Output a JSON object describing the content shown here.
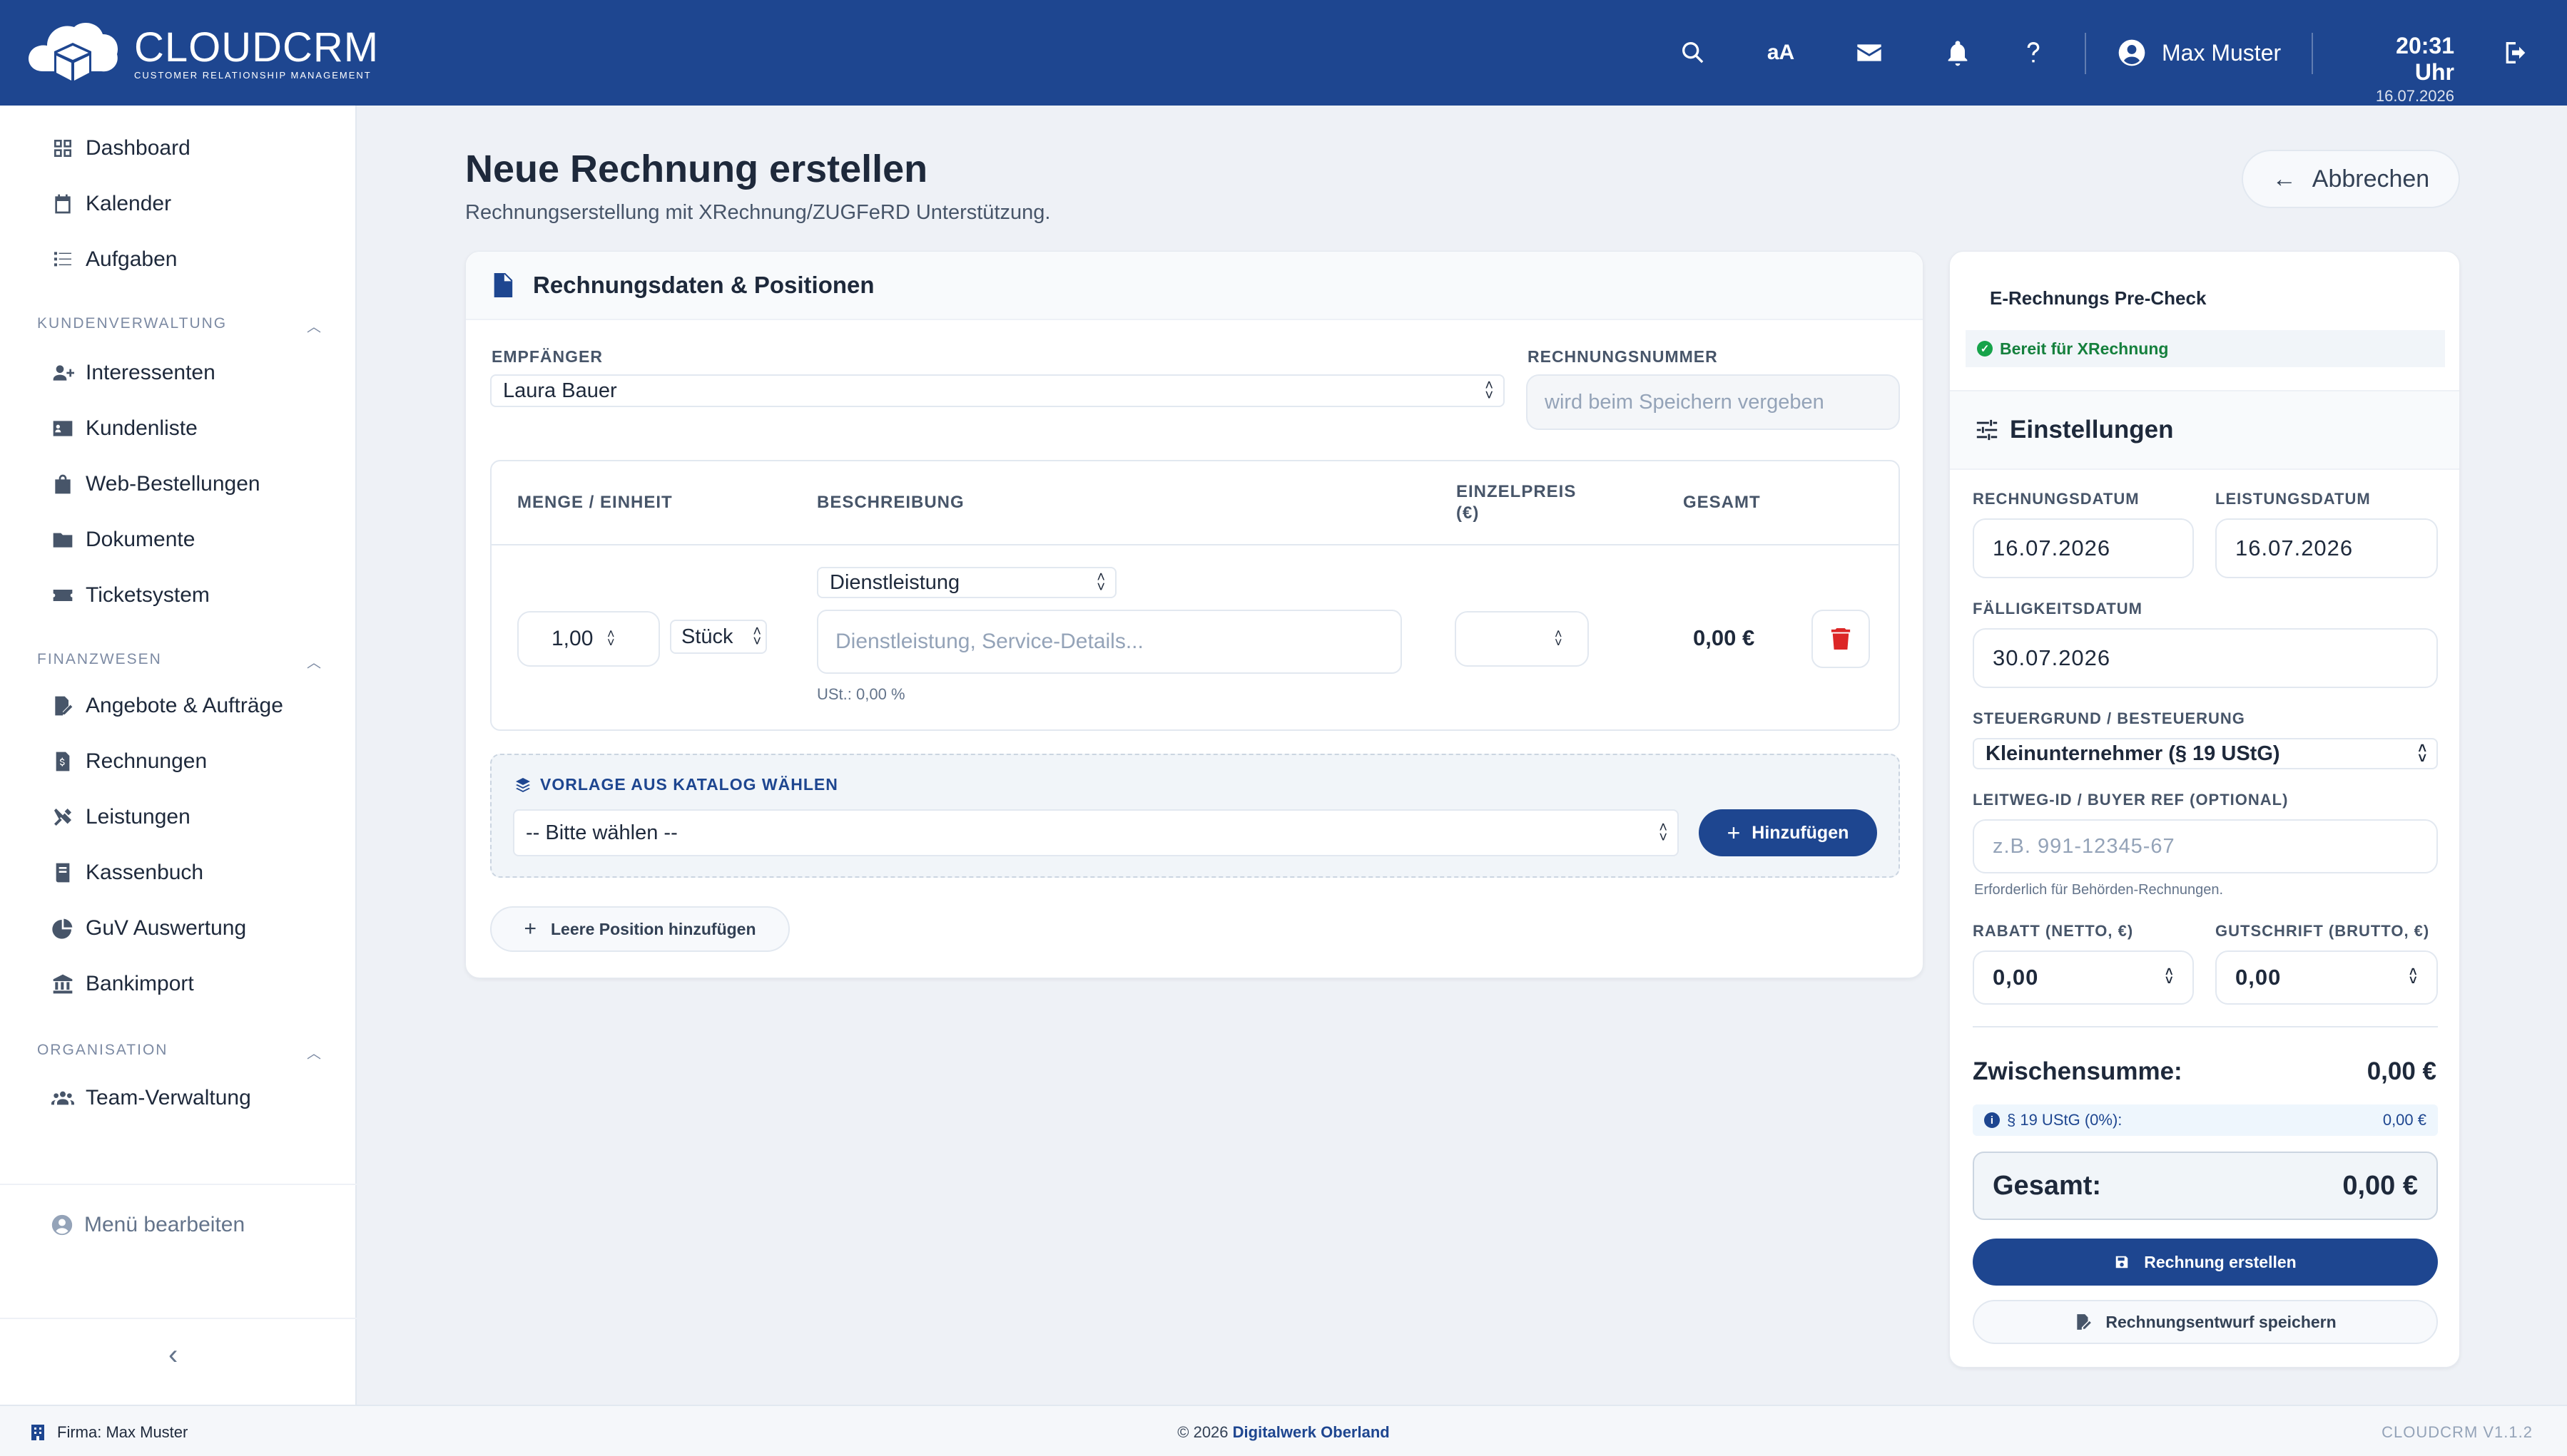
{
  "header": {
    "brand_title": "CLOUDCRM",
    "brand_subtitle": "CUSTOMER RELATIONSHIP MANAGEMENT",
    "font_size_label": "aA",
    "user_name": "Max Muster",
    "time": "20:31 Uhr",
    "date": "16.07.2026"
  },
  "sidebar": {
    "top_items": [
      {
        "label": "Dashboard",
        "icon": "dashboard-icon"
      },
      {
        "label": "Kalender",
        "icon": "calendar-icon"
      },
      {
        "label": "Aufgaben",
        "icon": "tasks-icon"
      }
    ],
    "sections": [
      {
        "title": "KUNDENVERWALTUNG",
        "items": [
          {
            "label": "Interessenten",
            "icon": "user-plus-icon"
          },
          {
            "label": "Kundenliste",
            "icon": "address-card-icon"
          },
          {
            "label": "Web-Bestellungen",
            "icon": "shopping-bag-icon"
          },
          {
            "label": "Dokumente",
            "icon": "folder-icon"
          },
          {
            "label": "Ticketsystem",
            "icon": "ticket-icon"
          }
        ]
      },
      {
        "title": "FINANZWESEN",
        "items": [
          {
            "label": "Angebote & Aufträge",
            "icon": "file-signature-icon"
          },
          {
            "label": "Rechnungen",
            "icon": "invoice-icon"
          },
          {
            "label": "Leistungen",
            "icon": "tools-icon"
          },
          {
            "label": "Kassenbuch",
            "icon": "book-icon"
          },
          {
            "label": "GuV Auswertung",
            "icon": "pie-chart-icon"
          },
          {
            "label": "Bankimport",
            "icon": "bank-icon"
          }
        ]
      },
      {
        "title": "ORGANISATION",
        "items": [
          {
            "label": "Team-Verwaltung",
            "icon": "users-icon"
          }
        ]
      }
    ],
    "menu_edit": "Menü bearbeiten"
  },
  "page": {
    "title": "Neue Rechnung erstellen",
    "subtitle": "Rechnungserstellung mit XRechnung/ZUGFeRD Unterstützung.",
    "cancel_label": "Abbrechen"
  },
  "form": {
    "card_title": "Rechnungsdaten & Positionen",
    "recipient_label": "EMPFÄNGER",
    "recipient_value": "Laura Bauer",
    "invoice_number_label": "RECHNUNGSNUMMER",
    "invoice_number_placeholder": "wird beim Speichern vergeben",
    "table_headers": {
      "qty": "MENGE / EINHEIT",
      "desc": "BESCHREIBUNG",
      "unit_price": "EINZELPREIS (€)",
      "total": "GESAMT"
    },
    "row": {
      "qty": "1,00",
      "unit": "Stück",
      "type": "Dienstleistung",
      "desc_placeholder": "Dienstleistung, Service-Details...",
      "vat_note": "USt.: 0,00 %",
      "total": "0,00 €"
    },
    "catalog_label": "VORLAGE AUS KATALOG WÄHLEN",
    "catalog_select": "-- Bitte wählen --",
    "add_label": "Hinzufügen",
    "empty_position_label": "Leere Position hinzufügen"
  },
  "side": {
    "precheck_title": "E-Rechnungs Pre-Check",
    "precheck_status": "Bereit für XRechnung",
    "settings_title": "Einstellungen",
    "invoice_date_label": "RECHNUNGSDATUM",
    "invoice_date": "16.07.2026",
    "service_date_label": "LEISTUNGSDATUM",
    "service_date": "16.07.2026",
    "due_date_label": "FÄLLIGKEITSDATUM",
    "due_date": "30.07.2026",
    "tax_label": "STEUERGRUND / BESTEUERUNG",
    "tax_value": "Kleinunternehmer (§ 19 UStG)",
    "leitweg_label": "LEITWEG-ID / BUYER REF (OPTIONAL)",
    "leitweg_placeholder": "z.B. 991-12345-67",
    "leitweg_hint": "Erforderlich für Behörden-Rechnungen.",
    "discount_label": "RABATT (NETTO, €)",
    "discount_value": "0,00",
    "credit_label": "GUTSCHRIFT (BRUTTO, €)",
    "credit_value": "0,00",
    "subtotal_label": "Zwischensumme:",
    "subtotal_value": "0,00 €",
    "tax_row_label": "§ 19 UStG (0%):",
    "tax_row_value": "0,00 €",
    "total_label": "Gesamt:",
    "total_value": "0,00 €",
    "create_label": "Rechnung erstellen",
    "draft_label": "Rechnungsentwurf speichern"
  },
  "footer": {
    "company": "Firma: Max Muster",
    "copyright_prefix": "© 2026",
    "copyright_link": "Digitalwerk Oberland",
    "version": "CLOUDCRM V1.1.2"
  },
  "colors": {
    "brand": "#1e4690",
    "danger": "#dc2626",
    "success": "#16a34a"
  }
}
